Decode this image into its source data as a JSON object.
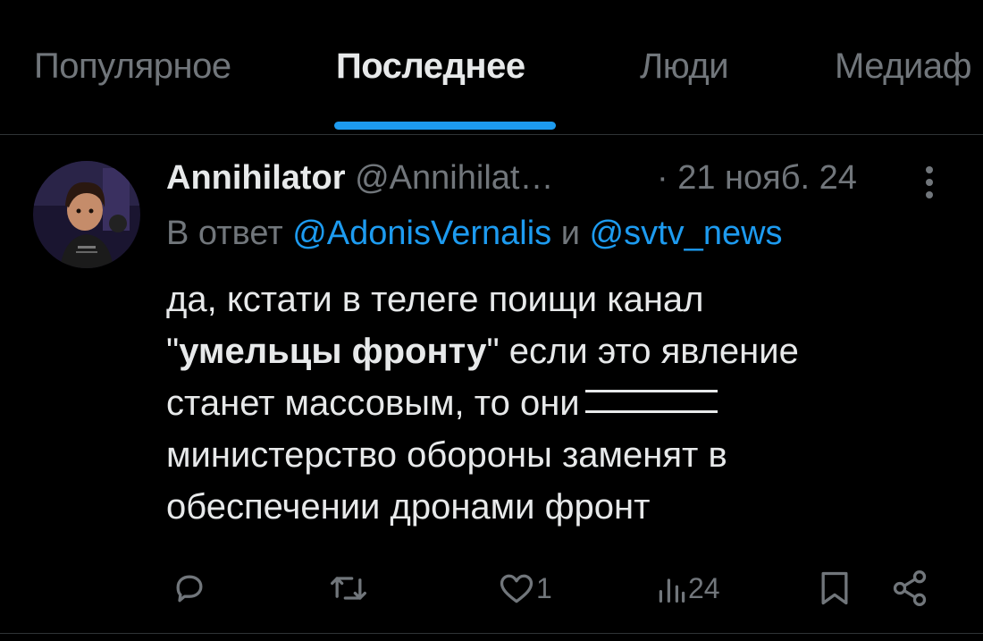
{
  "tabs": [
    "Популярное",
    "Последнее",
    "Люди",
    "Медиаф"
  ],
  "post": {
    "author_name": "Annihilator",
    "author_handle": "@Annihilat…",
    "date": "· 21 нояб. 24",
    "reply_prefix": "В ответ",
    "reply_mention_1": "@AdonisVernalis",
    "reply_joiner": "и",
    "reply_mention_2": "@svtv_news",
    "text_line1": "да, кстати в телеге поищи канал",
    "quote_open": "\"",
    "bold_phrase": "умельцы фронту",
    "text_after_bold": "\" если это явление",
    "text_line3": "станет массовым, то они",
    "text_line4": "министерство обороны заменят в",
    "text_line5": "обеспечении дронами фронт"
  },
  "actions": {
    "reply_count": "",
    "repost_count": "",
    "like_count": "1",
    "views_count": "24"
  },
  "colors": {
    "background": "#000000",
    "text": "#e7e9ea",
    "secondary": "#71767b",
    "accent": "#1d9bf0",
    "divider": "#2f3336"
  },
  "icons": [
    "comment-icon",
    "repost-icon",
    "heart-icon",
    "views-icon",
    "bookmark-icon",
    "share-icon",
    "more-icon"
  ]
}
